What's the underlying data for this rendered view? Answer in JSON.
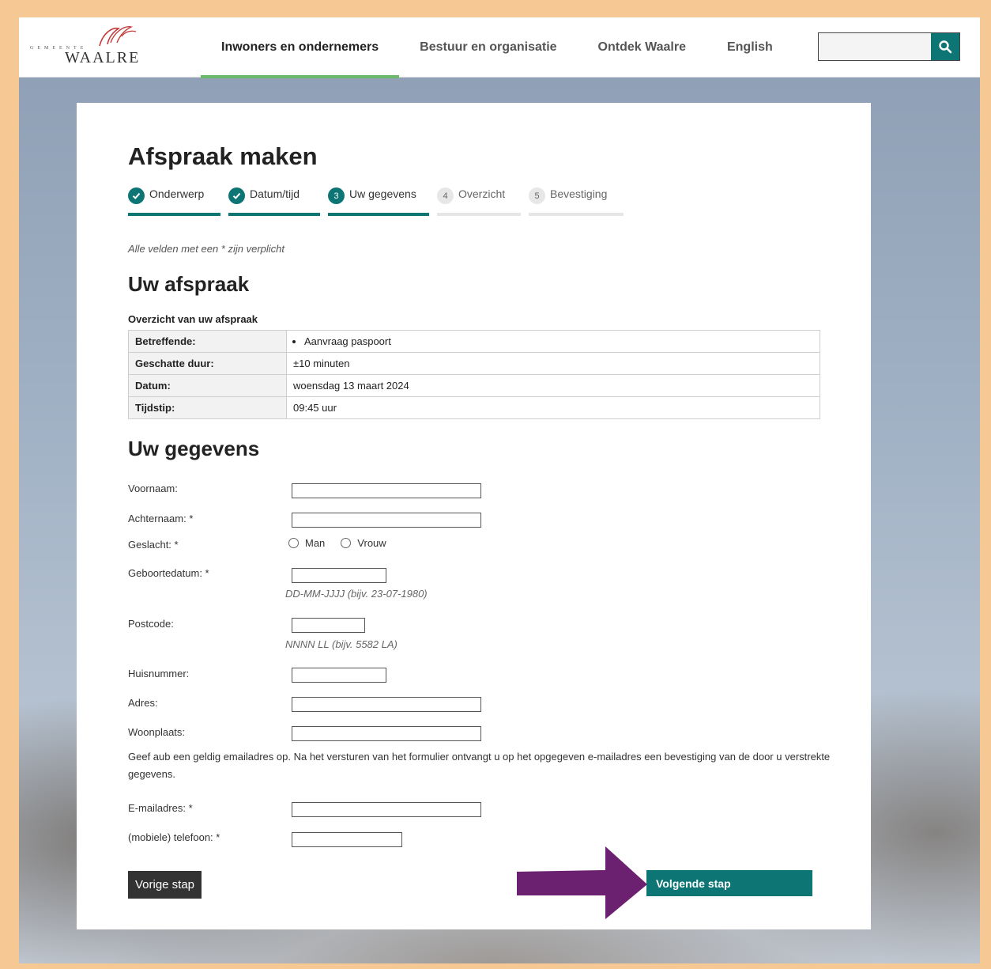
{
  "header": {
    "logo_small": "GEMEENTE",
    "logo_name": "WAALRE",
    "nav": [
      {
        "label": "Inwoners en ondernemers",
        "active": true
      },
      {
        "label": "Bestuur en organisatie",
        "active": false
      },
      {
        "label": "Ontdek Waalre",
        "active": false
      },
      {
        "label": "English",
        "active": false
      }
    ],
    "search": {
      "value": "",
      "icon": "search-icon"
    }
  },
  "page": {
    "title": "Afspraak maken",
    "steps": [
      {
        "num": "1",
        "label": "Onderwerp",
        "state": "done"
      },
      {
        "num": "2",
        "label": "Datum/tijd",
        "state": "done"
      },
      {
        "num": "3",
        "label": "Uw gegevens",
        "state": "current"
      },
      {
        "num": "4",
        "label": "Overzicht",
        "state": "todo"
      },
      {
        "num": "5",
        "label": "Bevestiging",
        "state": "todo"
      }
    ],
    "required_note": "Alle velden met een * zijn verplicht",
    "appointment": {
      "heading": "Uw afspraak",
      "caption": "Overzicht van uw afspraak",
      "rows": [
        {
          "key": "Betreffende:",
          "value": "Aanvraag paspoort"
        },
        {
          "key": "Geschatte duur:",
          "value": "±10 minuten"
        },
        {
          "key": "Datum:",
          "value": "woensdag 13 maart 2024"
        },
        {
          "key": "Tijdstip:",
          "value": "09:45 uur"
        }
      ]
    },
    "form": {
      "heading": "Uw gegevens",
      "voornaam": "Voornaam:",
      "achternaam": "Achternaam: *",
      "geslacht": "Geslacht: *",
      "gender_options": [
        "Man",
        "Vrouw"
      ],
      "geboortedatum": "Geboortedatum: *",
      "geboortedatum_hint": "DD-MM-JJJJ (bijv. 23-07-1980)",
      "postcode": "Postcode:",
      "postcode_hint": "NNNN LL (bijv. 5582 LA)",
      "huisnummer": "Huisnummer:",
      "adres": "Adres:",
      "woonplaats": "Woonplaats:",
      "email_note": "Geef aub een geldig emailadres op. Na het versturen van het formulier ontvangt u op het opgegeven e-mailadres een bevestiging van de door u verstrekte gegevens.",
      "email": "E-mailadres: *",
      "telefoon": "(mobiele) telefoon: *"
    },
    "buttons": {
      "prev": "Vorige stap",
      "next": "Volgende stap"
    },
    "colors": {
      "accent": "#0e7575",
      "nav_active": "#6cb86a",
      "arrow": "#6b2070",
      "frame": "#f6c893"
    }
  }
}
